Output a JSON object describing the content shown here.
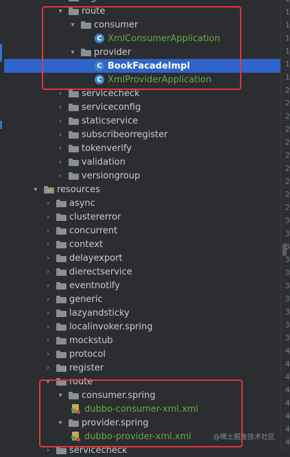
{
  "tree": {
    "rows": [
      {
        "label": "register",
        "kind": "folder",
        "arrow": ""
      },
      {
        "label": "route",
        "kind": "folder",
        "arrow": "▾"
      },
      {
        "label": "consumer",
        "kind": "folder",
        "arrow": "▾"
      },
      {
        "label": "XmlConsumerApplication",
        "kind": "class",
        "color": "green"
      },
      {
        "label": "provider",
        "kind": "folder",
        "arrow": "▾"
      },
      {
        "label": "BookFacadeImpl",
        "kind": "class",
        "selected": true
      },
      {
        "label": "XmlProviderApplication",
        "kind": "class",
        "color": "green"
      },
      {
        "label": "servicecheck",
        "kind": "folder",
        "arrow": "›"
      },
      {
        "label": "serviceconfig",
        "kind": "folder",
        "arrow": "›"
      },
      {
        "label": "staticservice",
        "kind": "folder",
        "arrow": "›"
      },
      {
        "label": "subscribeorregister",
        "kind": "folder",
        "arrow": "›"
      },
      {
        "label": "tokenverify",
        "kind": "folder",
        "arrow": "›"
      },
      {
        "label": "validation",
        "kind": "folder",
        "arrow": "›"
      },
      {
        "label": "versiongroup",
        "kind": "folder",
        "arrow": "›"
      },
      {
        "label": "resources",
        "kind": "resources",
        "arrow": "▾"
      },
      {
        "label": "async",
        "kind": "folder",
        "arrow": "›"
      },
      {
        "label": "clustererror",
        "kind": "folder",
        "arrow": "›"
      },
      {
        "label": "concurrent",
        "kind": "folder",
        "arrow": "›"
      },
      {
        "label": "context",
        "kind": "folder",
        "arrow": "›"
      },
      {
        "label": "delayexport",
        "kind": "folder",
        "arrow": "›"
      },
      {
        "label": "dierectservice",
        "kind": "folder",
        "arrow": "›"
      },
      {
        "label": "eventnotify",
        "kind": "folder",
        "arrow": "›"
      },
      {
        "label": "generic",
        "kind": "folder",
        "arrow": "›"
      },
      {
        "label": "lazyandsticky",
        "kind": "folder",
        "arrow": "›"
      },
      {
        "label": "localinvoker.spring",
        "kind": "folder",
        "arrow": "›"
      },
      {
        "label": "mockstub",
        "kind": "folder",
        "arrow": "›"
      },
      {
        "label": "protocol",
        "kind": "folder",
        "arrow": "›"
      },
      {
        "label": "register",
        "kind": "folder",
        "arrow": "›"
      },
      {
        "label": "route",
        "kind": "folder",
        "arrow": "▾"
      },
      {
        "label": "consumer.spring",
        "kind": "folder",
        "arrow": "▾"
      },
      {
        "label": "dubbo-consumer-xml.xml",
        "kind": "xml",
        "color": "green"
      },
      {
        "label": "provider.spring",
        "kind": "folder",
        "arrow": "▾"
      },
      {
        "label": "dubbo-provider-xml.xml",
        "kind": "xml",
        "color": "green"
      },
      {
        "label": "servicecheck",
        "kind": "folder",
        "arrow": "›"
      }
    ]
  },
  "gutter": {
    "line_numbers": [
      "1",
      "1",
      "1",
      "1",
      "1",
      "1",
      "1",
      "2",
      "2",
      "2",
      "2",
      "2",
      "2",
      "2",
      "2",
      "2",
      "2",
      "3",
      "3",
      "3",
      "3",
      "3",
      "3",
      "3",
      "3",
      "3",
      "3",
      "4",
      "4",
      "4",
      "4",
      "4",
      "4",
      "4",
      "4"
    ]
  },
  "watermark": "@稀土掘金技术社区",
  "colors": {
    "background": "#2b2d30",
    "selection": "#2f65ca",
    "highlight_box": "#e2393a",
    "green_text": "#6aaa44"
  }
}
